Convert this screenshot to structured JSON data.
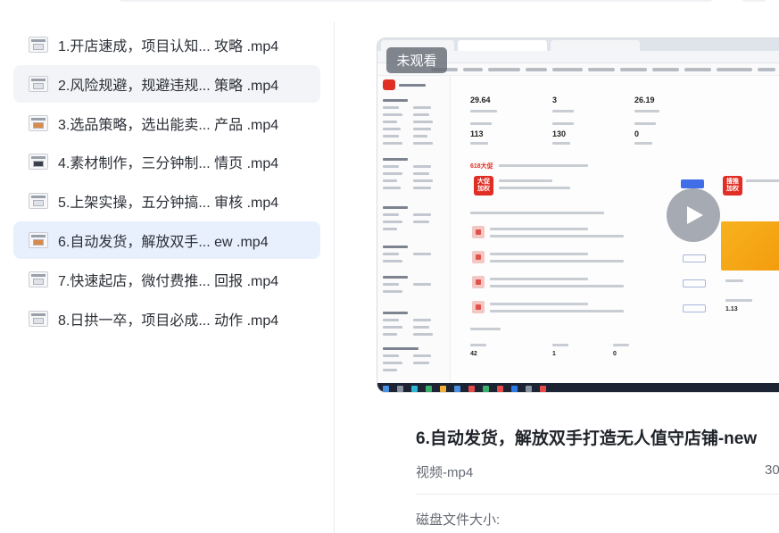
{
  "files": [
    {
      "label": "1.开店速成，项目认知... 攻略 .mp4",
      "thumb": "plain",
      "state": "normal"
    },
    {
      "label": "2.风险规避，规避违规... 策略 .mp4",
      "thumb": "plain",
      "state": "hover"
    },
    {
      "label": "3.选品策略，选出能卖... 产品 .mp4",
      "thumb": "color",
      "state": "normal"
    },
    {
      "label": "4.素材制作，三分钟制... 情页 .mp4",
      "thumb": "dark",
      "state": "normal"
    },
    {
      "label": "5.上架实操，五分钟搞... 审核 .mp4",
      "thumb": "plain",
      "state": "normal"
    },
    {
      "label": "6.自动发货，解放双手...   ew .mp4",
      "thumb": "color",
      "state": "active"
    },
    {
      "label": "7.快速起店，微付费推... 回报 .mp4",
      "thumb": "plain",
      "state": "normal"
    },
    {
      "label": "8.日拱一卒，项目必成... 动作 .mp4",
      "thumb": "plain",
      "state": "normal"
    }
  ],
  "player": {
    "badge": "未观看",
    "preview": {
      "stats": [
        "29.64",
        "3",
        "26.19",
        "113",
        "130",
        "0"
      ],
      "promo_label": "618大促",
      "promo_badge": "大促\n加权",
      "promo_badge2": "搜推\n加权",
      "bottom_stats": [
        "42",
        "1",
        "0"
      ],
      "side_value": "1.13"
    }
  },
  "details": {
    "title": "6.自动发货，解放双手打造无人值守店铺-new",
    "type": "视频-mp4",
    "size_right": "30",
    "disk_label": "磁盘文件大小:"
  },
  "colors": {
    "active_bg": "#e8f0fe",
    "hover_bg": "#f3f4f7",
    "accent_red": "#e02e24",
    "play_bg": "#969ba5"
  }
}
